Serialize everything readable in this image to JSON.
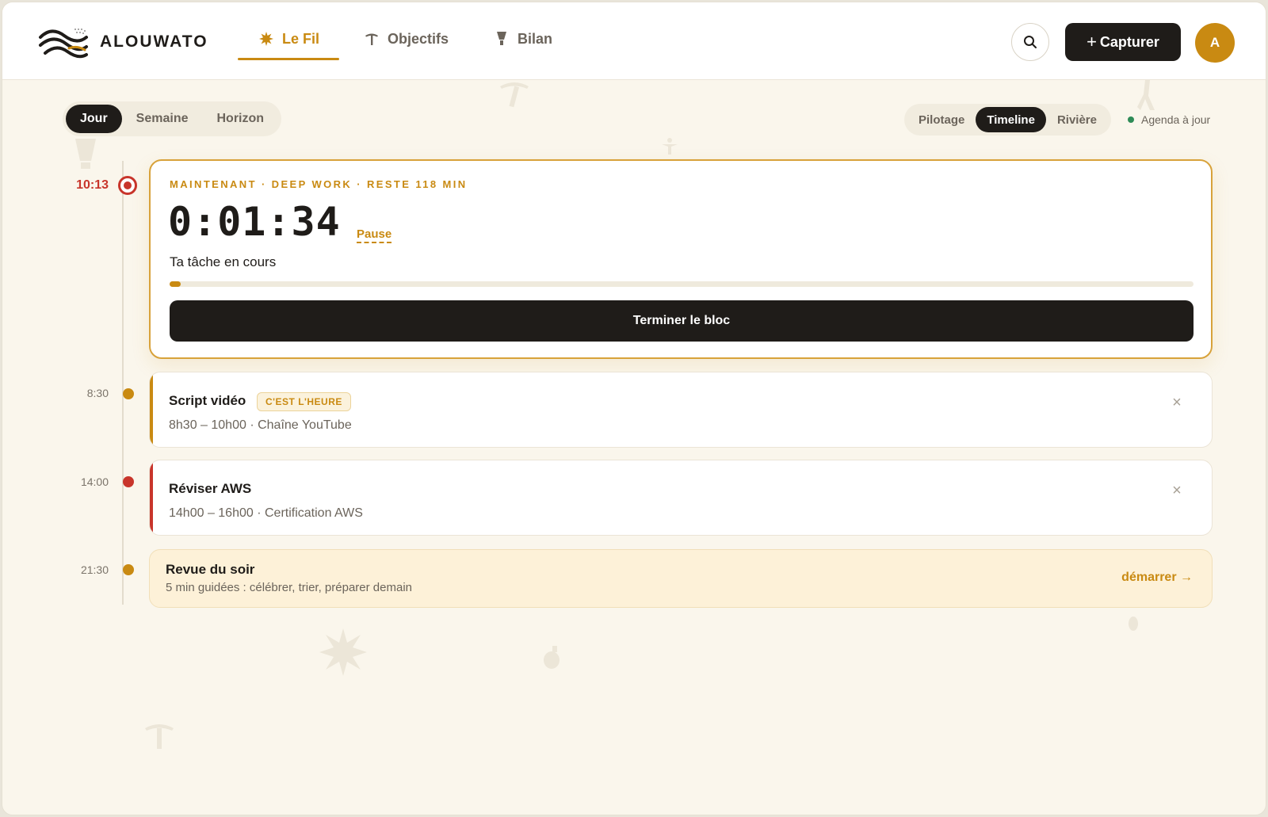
{
  "header": {
    "brand": "ALOUWATO",
    "nav": [
      {
        "label": "Le Fil",
        "icon": "sun-icon",
        "active": true
      },
      {
        "label": "Objectifs",
        "icon": "pickaxe-icon",
        "active": false
      },
      {
        "label": "Bilan",
        "icon": "trophy-icon",
        "active": false
      }
    ],
    "capture_label": "Capturer",
    "avatar_initial": "A"
  },
  "view_tabs": {
    "range": [
      "Jour",
      "Semaine",
      "Horizon"
    ],
    "range_active": "Jour",
    "mode": [
      "Pilotage",
      "Timeline",
      "Rivière"
    ],
    "mode_active": "Timeline",
    "sync_status": "Agenda à jour"
  },
  "current_block": {
    "time": "10:13",
    "eyebrow": "MAINTENANT · DEEP WORK · RESTE 118 MIN",
    "timer": "0:01:34",
    "pause_label": "Pause",
    "task": "Ta tâche en cours",
    "progress": 0.011,
    "finish_label": "Terminer le bloc"
  },
  "events": [
    {
      "time": "8:30",
      "title": "Script vidéo",
      "badge": "C'EST L'HEURE",
      "meta": "8h30 – 10h00 · Chaîne YouTube",
      "color": "#c98a12"
    },
    {
      "time": "14:00",
      "title": "Réviser AWS",
      "badge": "",
      "meta": "14h00 – 16h00 · Certification AWS",
      "color": "#c8352b"
    }
  ],
  "review": {
    "time": "21:30",
    "title": "Revue du soir",
    "meta": "5 min guidées : célébrer, trier, préparer demain",
    "start_label": "démarrer →"
  },
  "colors": {
    "accent": "#c98a12",
    "danger": "#c8352b",
    "ink": "#1f1c19",
    "success": "#2e8b57"
  }
}
